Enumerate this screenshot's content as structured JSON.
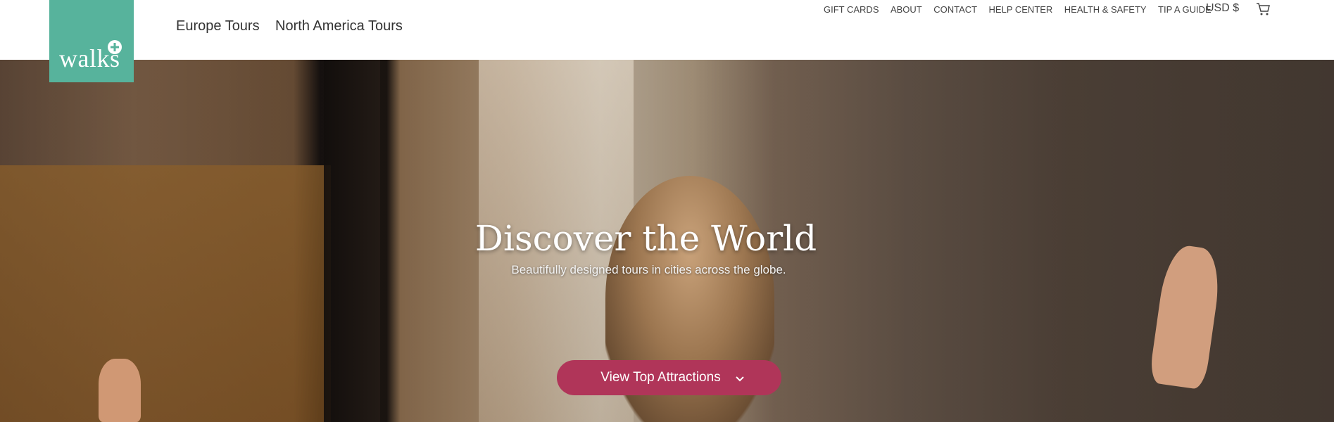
{
  "brand": {
    "logo_text": "walks",
    "color": "#57b39c"
  },
  "main_nav": [
    {
      "label": "Europe Tours"
    },
    {
      "label": "North America Tours"
    }
  ],
  "utility_nav": [
    {
      "label": "GIFT CARDS"
    },
    {
      "label": "ABOUT"
    },
    {
      "label": "CONTACT"
    },
    {
      "label": "HELP CENTER"
    },
    {
      "label": "HEALTH & SAFETY"
    },
    {
      "label": "TIP A GUIDE"
    }
  ],
  "currency": "USD $",
  "icons": {
    "cart": "cart-icon",
    "logo_plus": "plus-icon",
    "cta_chevron": "chevron-down-icon"
  },
  "hero": {
    "title": "Discover the World",
    "subtitle": "Beautifully designed tours in cities across the globe.",
    "cta_label": "View Top Attractions",
    "cta_color": "#b03559"
  }
}
